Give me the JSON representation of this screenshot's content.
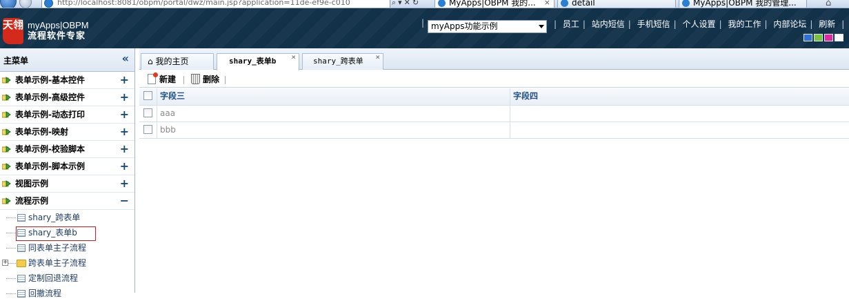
{
  "browser": {
    "address": "http://localhost:8081/obpm/portal/dwz/main.jsp?application=11de-ef9e-c010",
    "tabs": [
      {
        "label": "MyApps|OBPM 我的..."
      },
      {
        "label": "detail"
      },
      {
        "label": "MyApps|OBPM 我的管理..."
      }
    ]
  },
  "header": {
    "logo_text": "天翎",
    "app_name": "myApps|OBPM",
    "app_tagline": "流程软件专家",
    "app_select_value": "myApps功能示例",
    "nav": [
      "员工",
      "站内短信",
      "手机短信",
      "个人设置",
      "我的工作",
      "内部论坛",
      "刷新"
    ],
    "theme_colors": [
      "#2f6fd6",
      "#7ac142",
      "#e02ba0",
      "#ffffff"
    ]
  },
  "sidebar": {
    "title": "主菜单",
    "collapse_symbol": "«",
    "items": [
      {
        "label": "表单示例-基本控件",
        "toggle": "+"
      },
      {
        "label": "表单示例-高级控件",
        "toggle": "+"
      },
      {
        "label": "表单示例-动态打印",
        "toggle": "+"
      },
      {
        "label": "表单示例-映射",
        "toggle": "+"
      },
      {
        "label": "表单示例-校验脚本",
        "toggle": "+"
      },
      {
        "label": "表单示例-脚本示例",
        "toggle": "+"
      },
      {
        "label": "视图示例",
        "toggle": "+"
      },
      {
        "label": "流程示例",
        "toggle": "−"
      }
    ],
    "sub_items": [
      {
        "label": "shary_跨表单"
      },
      {
        "label": "shary_表单b"
      },
      {
        "label": "同表单主子流程"
      },
      {
        "label": "跨表单主子流程"
      },
      {
        "label": "定制回退流程"
      },
      {
        "label": "回撤流程"
      }
    ]
  },
  "main": {
    "tabs": [
      {
        "label": "我的主页"
      },
      {
        "label": "shary_表单b"
      },
      {
        "label": "shary_跨表单"
      }
    ],
    "toolbar": {
      "new_label": "新建",
      "delete_label": "删除"
    },
    "grid": {
      "columns": [
        "字段三",
        "字段四"
      ],
      "rows": [
        {
          "field3": "aaa",
          "field4": ""
        },
        {
          "field3": "bbb",
          "field4": ""
        }
      ]
    }
  }
}
